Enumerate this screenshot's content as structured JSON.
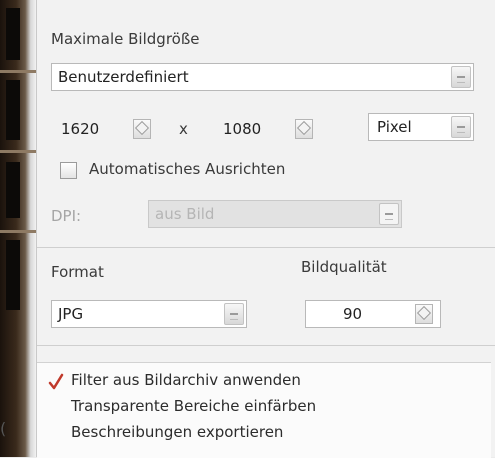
{
  "max_size": {
    "label": "Maximale Bildgröße",
    "preset": "Benutzerdefiniert",
    "width": "1620",
    "times_label": "x",
    "height": "1080",
    "unit": "Pixel",
    "auto_align_label": "Automatisches Ausrichten",
    "auto_align_checked": false,
    "dpi_label": "DPI:",
    "dpi_value": "aus Bild"
  },
  "format": {
    "label": "Format",
    "value": "JPG",
    "quality_label": "Bildqualität",
    "quality_value": "90"
  },
  "options": [
    {
      "label": "Filter aus Bildarchiv anwenden",
      "checked": true
    },
    {
      "label": "Transparente Bereiche einfärben",
      "checked": false
    },
    {
      "label": "Beschreibungen exportieren",
      "checked": false
    }
  ],
  "icons": {
    "checkmark": "check-icon",
    "combo_arrow": "chevron-down-icon",
    "spinner": "spinner-icon"
  },
  "colors": {
    "checkmark": "#c0392b",
    "panel_bg": "#f2f2f2",
    "list_bg": "#fbfbfb"
  }
}
